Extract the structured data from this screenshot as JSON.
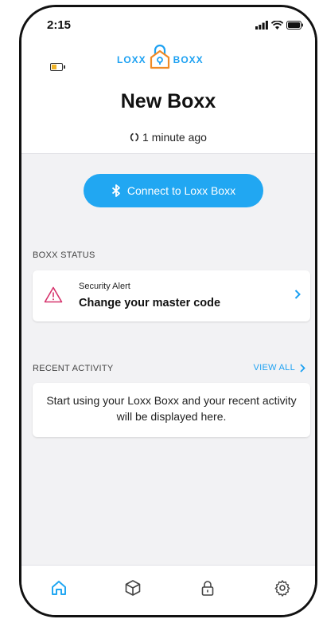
{
  "status_bar": {
    "time": "2:15"
  },
  "logo": {
    "left": "LOXX",
    "right": "BOXX"
  },
  "header": {
    "title": "New Boxx",
    "sync_text": "1 minute ago"
  },
  "connect_button": {
    "label": "Connect to Loxx Boxx"
  },
  "boxx_status": {
    "section_label": "BOXX STATUS",
    "alert_title": "Security Alert",
    "alert_text": "Change your master code"
  },
  "recent_activity": {
    "section_label": "RECENT ACTIVITY",
    "view_all": "VIEW ALL",
    "empty_text": "Start using your Loxx Boxx and your recent activity will be displayed here."
  },
  "tabs": [
    {
      "icon": "home-icon",
      "active": true
    },
    {
      "icon": "box-icon",
      "active": false
    },
    {
      "icon": "lock-icon",
      "active": false
    },
    {
      "icon": "gear-icon",
      "active": false
    }
  ],
  "colors": {
    "accent": "#21a7f2",
    "alert": "#d6336c",
    "battery": "#f0b429"
  }
}
